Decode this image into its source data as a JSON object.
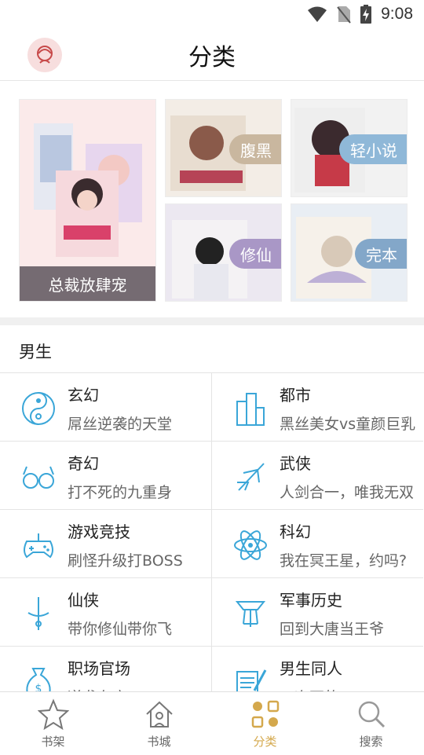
{
  "status_bar": {
    "time": "9:08"
  },
  "header": {
    "title": "分类"
  },
  "banner": {
    "big_label": "总裁放肆宠",
    "tags": [
      "腹黑",
      "轻小说",
      "修仙",
      "完本"
    ]
  },
  "section": {
    "title": "男生"
  },
  "categories": [
    {
      "name": "玄幻",
      "desc": "屌丝逆袭的天堂",
      "icon": "yin-yang-icon"
    },
    {
      "name": "都市",
      "desc": "黑丝美女vs童颜巨乳",
      "icon": "city-buildings-icon"
    },
    {
      "name": "奇幻",
      "desc": "打不死的九重身",
      "icon": "glasses-icon"
    },
    {
      "name": "武侠",
      "desc": "人剑合一，唯我无双",
      "icon": "swordsman-icon"
    },
    {
      "name": "游戏竞技",
      "desc": "刷怪升级打BOSS",
      "icon": "gamepad-icon"
    },
    {
      "name": "科幻",
      "desc": "我在冥王星，约吗?",
      "icon": "atom-icon"
    },
    {
      "name": "仙侠",
      "desc": "带你修仙带你飞",
      "icon": "sword-icon"
    },
    {
      "name": "军事历史",
      "desc": "回到大唐当王爷",
      "icon": "lantern-icon"
    },
    {
      "name": "职场官场",
      "desc": "逆袭在官",
      "icon": "money-bag-icon"
    },
    {
      "name": "男生同人",
      "desc": "一次不的",
      "icon": "notebook-pen-icon"
    }
  ],
  "bottom_nav": [
    {
      "label": "书架",
      "icon": "star-icon",
      "active": false
    },
    {
      "label": "书城",
      "icon": "home-icon",
      "active": false
    },
    {
      "label": "分类",
      "icon": "category-grid-icon",
      "active": true
    },
    {
      "label": "搜索",
      "icon": "search-icon",
      "active": false
    }
  ],
  "colors": {
    "accent": "#d4a84c",
    "category_icon": "#3aa6d8"
  }
}
